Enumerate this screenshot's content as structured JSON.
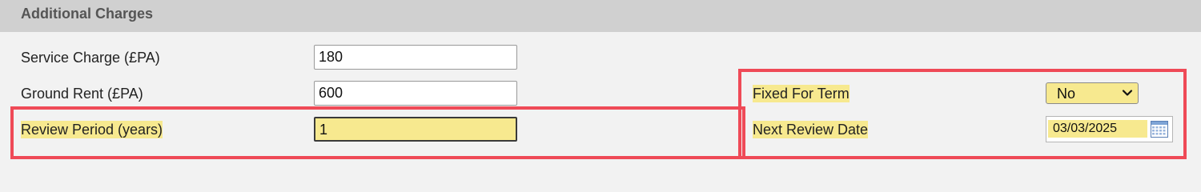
{
  "section": {
    "title": "Additional Charges"
  },
  "fields": {
    "service_charge": {
      "label": "Service Charge (£PA)",
      "value": "180"
    },
    "ground_rent": {
      "label": "Ground Rent (£PA)",
      "value": "600"
    },
    "review_period": {
      "label": "Review Period (years)",
      "value": "1"
    },
    "fixed_for_term": {
      "label": "Fixed For Term",
      "value": "No"
    },
    "next_review_date": {
      "label": "Next Review Date",
      "value": "03/03/2025"
    }
  },
  "icons": {
    "dropdown": "chevron-down-icon",
    "date_picker": "calendar-icon"
  },
  "colors": {
    "highlight": "#f7e98f",
    "annotation_border": "#ef4a57",
    "header_bg": "#d0d0d0",
    "panel_bg": "#f2f2f2"
  }
}
